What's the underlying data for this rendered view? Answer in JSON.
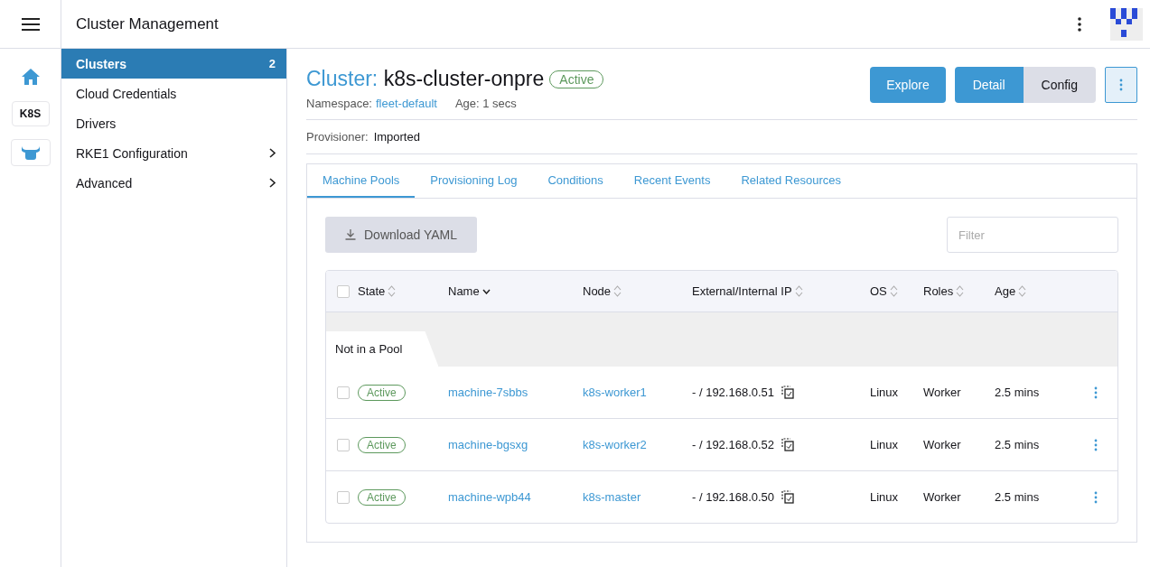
{
  "header": {
    "title": "Cluster Management"
  },
  "rail": [
    {
      "kind": "home",
      "selected": false
    },
    {
      "kind": "text",
      "label": "K8S",
      "selected": false
    },
    {
      "kind": "bull",
      "selected": false
    }
  ],
  "sidebar": {
    "items": [
      {
        "label": "Clusters",
        "count": "2",
        "selected": true,
        "expandable": false
      },
      {
        "label": "Cloud Credentials",
        "selected": false,
        "expandable": false
      },
      {
        "label": "Drivers",
        "selected": false,
        "expandable": false
      },
      {
        "label": "RKE1 Configuration",
        "selected": false,
        "expandable": true
      },
      {
        "label": "Advanced",
        "selected": false,
        "expandable": true
      }
    ]
  },
  "cluster": {
    "type_label": "Cluster:",
    "name": "k8s-cluster-onpre",
    "status": "Active",
    "namespace_label": "Namespace:",
    "namespace": "fleet-default",
    "age": "Age: 1 secs",
    "provisioner_label": "Provisioner:",
    "provisioner": "Imported"
  },
  "actions": {
    "explore": "Explore",
    "views": [
      {
        "label": "Detail",
        "selected": true
      },
      {
        "label": "Config",
        "selected": false
      }
    ]
  },
  "tabs": [
    {
      "label": "Machine Pools",
      "selected": true
    },
    {
      "label": "Provisioning Log",
      "selected": false
    },
    {
      "label": "Conditions",
      "selected": false
    },
    {
      "label": "Recent Events",
      "selected": false
    },
    {
      "label": "Related Resources",
      "selected": false
    }
  ],
  "download_button": "Download YAML",
  "filter": {
    "placeholder": "Filter"
  },
  "table": {
    "select_all": false,
    "columns": [
      {
        "label": "State",
        "sorted": false
      },
      {
        "label": "Name",
        "sorted": true
      },
      {
        "label": "Node",
        "sorted": false
      },
      {
        "label": "External/Internal IP",
        "sorted": false
      },
      {
        "label": "OS",
        "sorted": false
      },
      {
        "label": "Roles",
        "sorted": false
      },
      {
        "label": "Age",
        "sorted": false
      }
    ],
    "group": "Not in a Pool",
    "rows": [
      {
        "checked": false,
        "state": "Active",
        "name": "machine-7sbbs",
        "node": "k8s-worker1",
        "ip": "- / 192.168.0.51",
        "os": "Linux",
        "roles": "Worker",
        "age": "2.5 mins"
      },
      {
        "checked": false,
        "state": "Active",
        "name": "machine-bgsxg",
        "node": "k8s-worker2",
        "ip": "- / 192.168.0.52",
        "os": "Linux",
        "roles": "Worker",
        "age": "2.5 mins"
      },
      {
        "checked": false,
        "state": "Active",
        "name": "machine-wpb44",
        "node": "k8s-master",
        "ip": "- / 192.168.0.50",
        "os": "Linux",
        "roles": "Worker",
        "age": "2.5 mins"
      }
    ]
  }
}
